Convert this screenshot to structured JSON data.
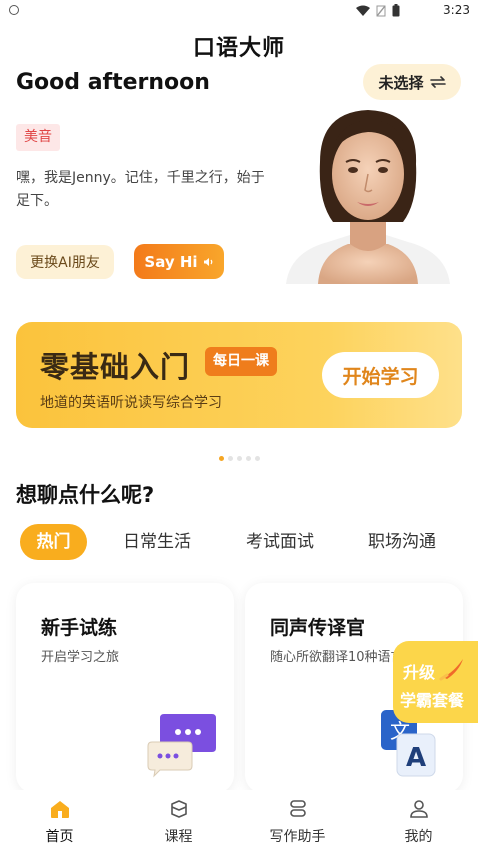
{
  "status_bar": {
    "time": "3:23"
  },
  "app": {
    "title": "口语大师"
  },
  "header": {
    "greeting": "Good afternoon",
    "role_selector_label": "未选择"
  },
  "tutor": {
    "accent": "美音",
    "intro": "嘿，我是Jenny。记住，千里之行，始于足下。",
    "change_button": "更换AI朋友",
    "say_hi_button": "Say Hi"
  },
  "banner": {
    "title": "零基础入门",
    "tag": "每日一课",
    "subtitle": "地道的英语听说读写综合学习",
    "button": "开始学习",
    "page_count": 5,
    "active_page": 0
  },
  "topics": {
    "title": "想聊点什么呢?",
    "tabs": [
      {
        "label": "热门",
        "active": true
      },
      {
        "label": "日常生活",
        "active": false
      },
      {
        "label": "考试面试",
        "active": false
      },
      {
        "label": "职场沟通",
        "active": false
      }
    ],
    "cards": [
      {
        "title": "新手试练",
        "subtitle": "开启学习之旅",
        "icon": "chat-bubbles-icon"
      },
      {
        "title": "同声传译官",
        "subtitle": "随心所欲翻译10种语言",
        "icon": "translate-icon"
      }
    ]
  },
  "upgrade": {
    "line1": "升级",
    "line2": "学霸套餐"
  },
  "bottom_nav": {
    "items": [
      {
        "label": "首页",
        "icon": "home-icon",
        "active": true
      },
      {
        "label": "课程",
        "icon": "course-icon",
        "active": false
      },
      {
        "label": "写作助手",
        "icon": "writing-icon",
        "active": false
      },
      {
        "label": "我的",
        "icon": "profile-icon",
        "active": false
      }
    ]
  },
  "colors": {
    "accent": "#f9ad1e",
    "banner": "#fcc83e",
    "badge_red": "#e04545",
    "say_hi": "#f37a1a"
  }
}
